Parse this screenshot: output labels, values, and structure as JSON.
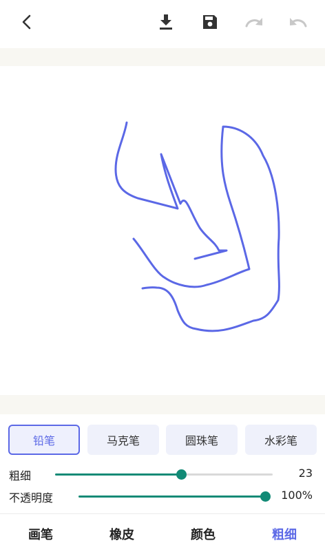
{
  "toolbar": {
    "back_icon": "chevron-left-icon",
    "download_icon": "download-icon",
    "save_icon": "save-icon",
    "redo_icon": "redo-icon",
    "undo_icon": "undo-icon",
    "icon_color": "#333333",
    "disabled_color": "#c8c8c8"
  },
  "canvas": {
    "stroke_color": "#5b68e6"
  },
  "brushes": {
    "items": [
      {
        "label": "铅笔",
        "active": true
      },
      {
        "label": "马克笔",
        "active": false
      },
      {
        "label": "圆珠笔",
        "active": false
      },
      {
        "label": "水彩笔",
        "active": false
      }
    ]
  },
  "sliders": {
    "thickness": {
      "label": "粗细",
      "value": "23",
      "fraction": 0.58
    },
    "opacity": {
      "label": "不透明度",
      "value": "100%",
      "fraction": 1.0
    }
  },
  "tabs": [
    {
      "label": "画笔",
      "active": false
    },
    {
      "label": "橡皮",
      "active": false
    },
    {
      "label": "颜色",
      "active": false
    },
    {
      "label": "粗细",
      "active": true
    }
  ],
  "colors": {
    "accent": "#5b68e6",
    "slider": "#128a76"
  }
}
